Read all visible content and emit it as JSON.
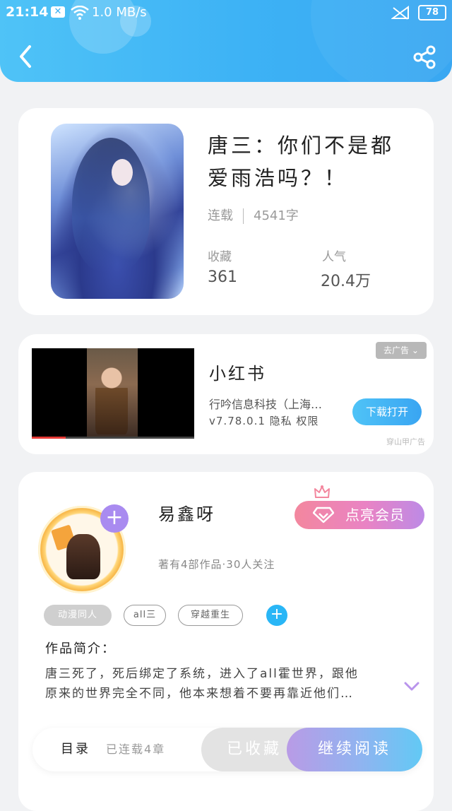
{
  "status_bar": {
    "time": "21:14",
    "notification_badge": "✕",
    "network_speed": "1.0 MB/s",
    "battery": "78"
  },
  "icons": {
    "back": "back-arrow-icon",
    "share": "share-icon",
    "expand": "chevron-down-icon"
  },
  "book": {
    "title": "唐三：你们不是都爱雨浩吗？！",
    "status": "连载",
    "word_count": "4541字",
    "favorites_label": "收藏",
    "favorites_value": "361",
    "popularity_label": "人气",
    "popularity_value": "20.4万"
  },
  "ad": {
    "close_label": "去广告",
    "app_name": "小红书",
    "company": "行吟信息科技（上海…",
    "meta": "v7.78.0.1  隐私  权限",
    "download_label": "下载打开",
    "source": "穿山甲广告"
  },
  "author": {
    "name": "易鑫呀",
    "info": "著有4部作品·30人关注",
    "vip_label": "点亮会员",
    "tags": [
      "动漫同人",
      "all三",
      "穿越重生"
    ],
    "intro_title": "作品简介：",
    "intro_text": "唐三死了，死后绑定了系统，进入了all霍世界，跟他\n原来的世界完全不同，他本来想着不要再靠近他们…"
  },
  "bottom_bar": {
    "toc_label": "目录",
    "chapter_count": "已连载4章",
    "favorited_label": "已收藏",
    "continue_label": "继续阅读"
  },
  "colors": {
    "header_blue": "#3db2f5",
    "vip_pink": "#f3879e",
    "vip_purple": "#bd8ae6",
    "accent_purple": "#a98bf0",
    "accent_blue": "#29b6f6"
  }
}
